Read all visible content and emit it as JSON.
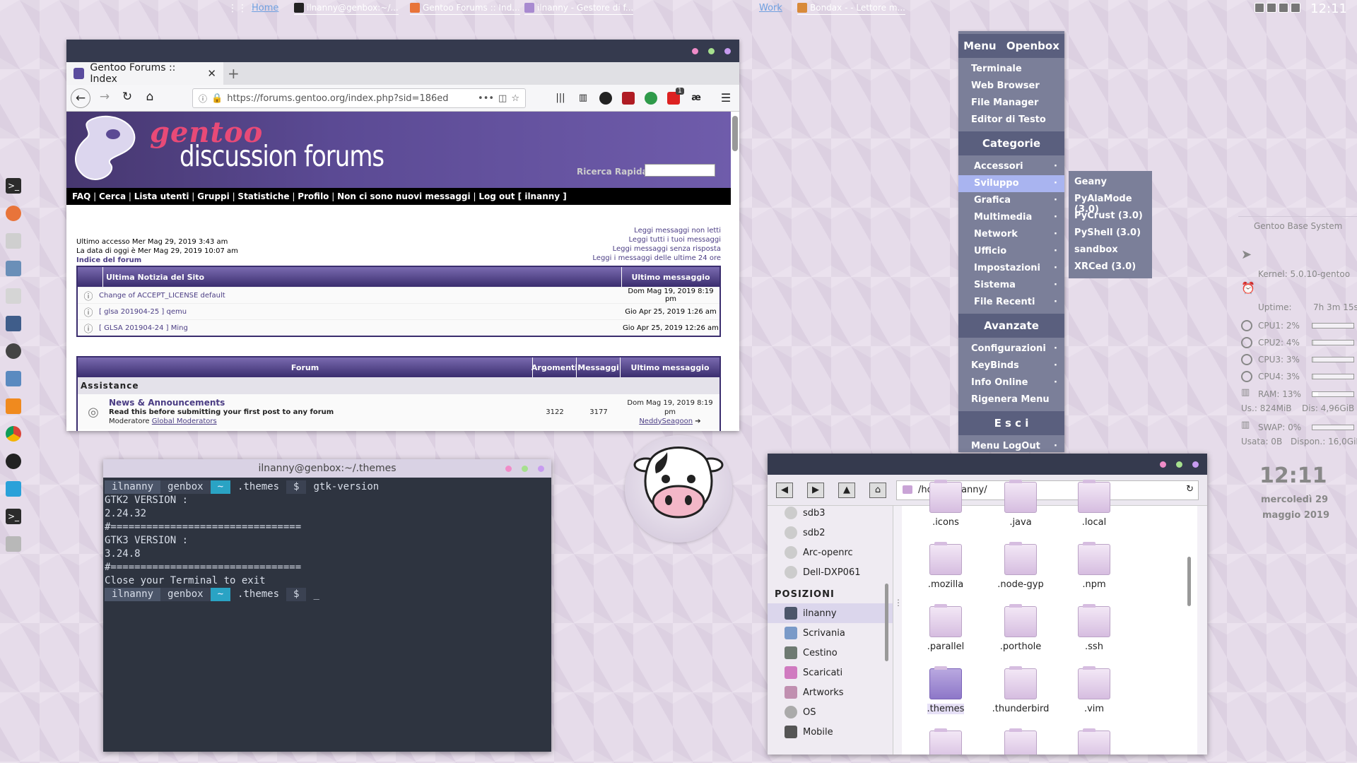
{
  "top_panel": {
    "desktops": [
      "Home",
      "Work"
    ],
    "tasks": [
      {
        "label": "ilnanny@genbox:~/...",
        "icon": "terminal-icon",
        "color": "#222222"
      },
      {
        "label": "Gentoo Forums :: Ind...",
        "icon": "firefox-icon",
        "color": "#e8743a"
      },
      {
        "label": "ilnanny - Gestore di f...",
        "icon": "file-manager-icon",
        "color": "#a88ad0"
      },
      {
        "label": "Bondax - - Lettore m...",
        "icon": "audio-player-icon",
        "color": "#d88a3a"
      }
    ],
    "clock": "12:11"
  },
  "dock": {
    "icons": [
      "terminal-icon",
      "firefox-icon",
      "text-editor-icon",
      "calculator-icon",
      "mail-icon",
      "writer-icon",
      "settings-icon",
      "equalizer-icon",
      "vlc-icon",
      "chrome-icon",
      "disc-icon",
      "telegram-icon",
      "terminal-icon",
      "screenshot-icon"
    ]
  },
  "browser": {
    "tab_title": "Gentoo Forums :: Index",
    "url": "https://forums.gentoo.org/index.php?sid=186ed",
    "badge": "1"
  },
  "forum": {
    "title_line1": "gentoo",
    "title_line2": "discussion forums",
    "quick_search_label": "Ricerca Rapida:",
    "menu": [
      "FAQ",
      "Cerca",
      "Lista utenti",
      "Gruppi",
      "Statistiche",
      "Profilo",
      "Non ci sono nuovi messaggi",
      "Log out [ ilnanny ]"
    ],
    "last_access": "Ultimo accesso Mer Mag 29, 2019 3:43 am",
    "today": "La data di oggi è Mer Mag 29, 2019 10:07 am",
    "index_link": "Indice del forum",
    "quick_links": [
      "Leggi messaggi non letti",
      "Leggi tutti i tuoi messaggi",
      "Leggi messaggi senza risposta",
      "Leggi i messaggi delle ultime 24 ore"
    ],
    "news_header": "Ultima Notizia del Sito",
    "news_last_header": "Ultimo messaggio",
    "news": [
      {
        "title": "Change of ACCEPT_LICENSE default",
        "date": "Dom Mag 19, 2019 8:19 pm"
      },
      {
        "title": "[ glsa 201904-25 ] qemu",
        "date": "Gio Apr 25, 2019 1:26 am"
      },
      {
        "title": "[ GLSA 201904-24 ] Ming",
        "date": "Gio Apr 25, 2019 12:26 am"
      }
    ],
    "forum_headers": {
      "forum": "Forum",
      "topics": "Argomenti",
      "posts": "Messaggi",
      "last": "Ultimo messaggio"
    },
    "section": "Assistance",
    "forum_row": {
      "name": "News & Announcements",
      "desc": "Read this before submitting your first post to any forum",
      "mod_label": "Moderatore",
      "mod_link": "Global Moderators",
      "topics": "3122",
      "posts": "3177",
      "last_date": "Dom Mag 19, 2019 8:19 pm",
      "last_user": "NeddySeagoon"
    }
  },
  "openbox_menu": {
    "header_menu": "Menu",
    "header_openbox": "Openbox",
    "apps": [
      "Terminale",
      "Web Browser",
      "File Manager",
      "Editor di Testo"
    ],
    "categories_header": "Categorie",
    "categories": [
      "Accessori",
      "Sviluppo",
      "Grafica",
      "Multimedia",
      "Network",
      "Ufficio",
      "Impostazioni",
      "Sistema",
      "File  Recenti"
    ],
    "advanced_header": "Avanzate",
    "advanced": [
      "Configurazioni",
      "KeyBinds",
      "Info   Online",
      "Rigenera  Menu"
    ],
    "exit_header": "E s c i",
    "exit_items": [
      "Menu  LogOut"
    ],
    "submenu": [
      "Geany",
      "PyAlaMode (3.0)",
      "PyCrust (3.0)",
      "PyShell (3.0)",
      "sandbox",
      "XRCed (3.0)"
    ]
  },
  "conky": {
    "title": "Gentoo Base System",
    "kernel": "Kernel:   5.0.10-gentoo",
    "uptime_label": "Uptime:",
    "uptime": "7h 3m 15s",
    "cpus": [
      {
        "label": "CPU1: 2%",
        "value": 2
      },
      {
        "label": "CPU2: 4%",
        "value": 4
      },
      {
        "label": "CPU3: 3%",
        "value": 3
      },
      {
        "label": "CPU4: 3%",
        "value": 3
      }
    ],
    "ram": {
      "label": "RAM: 13%",
      "value": 13,
      "used": "Us.: 824MiB",
      "disp": "Dis: 4,96GiB"
    },
    "swap": {
      "label": "SWAP: 0%",
      "value": 0,
      "used": "Usata: 0B",
      "disp": "Dispon.: 16,0GiB"
    },
    "time": "12:11",
    "day": "mercoledì 29",
    "month": "maggio 2019"
  },
  "terminal": {
    "title": "ilnanny@genbox:~/.themes",
    "user": "ilnanny",
    "host": "genbox",
    "home": "~",
    "dir": ".themes",
    "symbol": "$",
    "command": "gtk-version",
    "lines": [
      "GTK2 VERSION :",
      "2.24.32",
      "#================================",
      "GTK3 VERSION :",
      "3.24.8",
      "#================================",
      "Close your Terminal to exit"
    ],
    "cursor": "_"
  },
  "file_manager": {
    "path": "/home/ilnanny/",
    "devices": [
      "sdb3",
      "sdb2",
      "Arc-openrc",
      "Dell-DXP061"
    ],
    "places_header": "POSIZIONI",
    "places": [
      {
        "label": "ilnanny",
        "icon": "home-icon",
        "color": "#4c566a"
      },
      {
        "label": "Scrivania",
        "icon": "desktop-icon",
        "color": "#7a9ac8"
      },
      {
        "label": "Cestino",
        "icon": "trash-icon",
        "color": "#6e7a72"
      },
      {
        "label": "Scaricati",
        "icon": "downloads-icon",
        "color": "#d07ac0"
      },
      {
        "label": "Artworks",
        "icon": "pictures-icon",
        "color": "#c08fb0"
      },
      {
        "label": "OS",
        "icon": "drive-icon",
        "color": "#aaaaaa"
      },
      {
        "label": "Mobile",
        "icon": "phone-icon",
        "color": "#555555"
      }
    ],
    "folders": [
      ".icons",
      ".java",
      ".local",
      ".mozilla",
      ".node-gyp",
      ".npm",
      ".parallel",
      ".porthole",
      ".ssh",
      ".themes",
      ".thunderbird",
      ".vim"
    ],
    "selected_folder": ".themes"
  }
}
